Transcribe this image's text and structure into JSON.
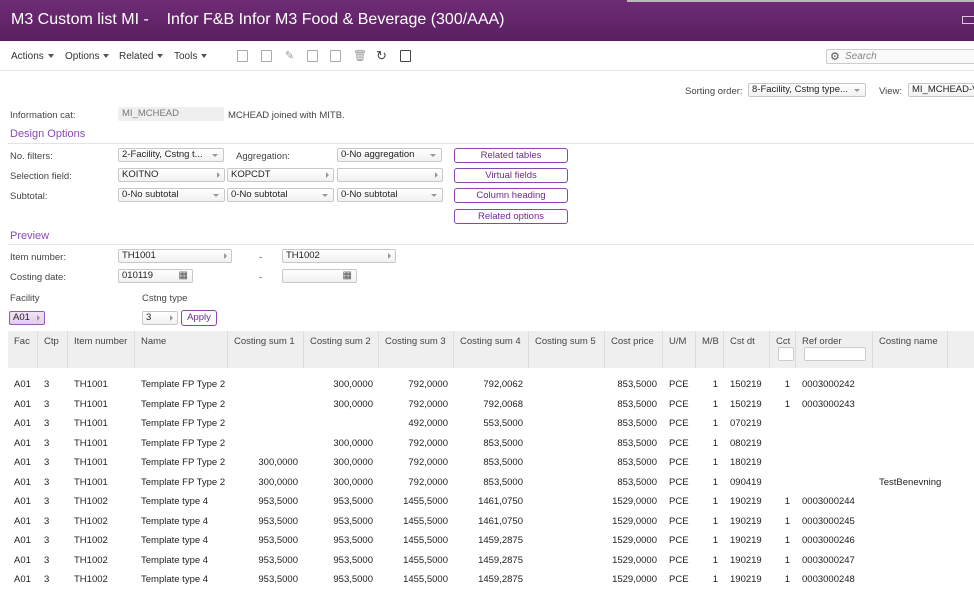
{
  "window": {
    "title": "M3 Custom list MI -    Infor F&B Infor M3 Food & Beverage (300/AAA)"
  },
  "toolbar": {
    "menus": [
      "Actions",
      "Options",
      "Related",
      "Tools"
    ],
    "icons": [
      "new-icon",
      "open-icon",
      "edit-icon",
      "copy-icon",
      "display-icon",
      "delete-icon",
      "refresh-icon",
      "document-icon"
    ],
    "search_placeholder": "Search"
  },
  "sorting": {
    "label": "Sorting order:",
    "value": "8-Facility, Cstng type...",
    "view_label": "View:",
    "view_value": "MI_MCHEAD-V"
  },
  "info": {
    "label": "Information cat:",
    "value": "MI_MCHEAD",
    "description": "MCHEAD joined with MITB."
  },
  "design": {
    "heading": "Design Options",
    "no_filters_label": "No. filters:",
    "no_filters_value": "2-Facility, Cstng t...",
    "aggregation_label": "Aggregation:",
    "aggregation_value": "0-No aggregation",
    "selection_label": "Selection field:",
    "selection_values": [
      "KOITNO",
      "KOPCDT",
      ""
    ],
    "subtotal_label": "Subtotal:",
    "subtotal_values": [
      "0-No subtotal",
      "0-No subtotal",
      "0-No subtotal"
    ],
    "buttons": [
      "Related tables",
      "Virtual fields",
      "Column heading",
      "Related options"
    ]
  },
  "preview": {
    "heading": "Preview",
    "item_label": "Item number:",
    "item_from": "TH1001",
    "item_to": "TH1002",
    "date_label": "Costing date:",
    "date_from": "010119",
    "date_to": "",
    "dash": "-",
    "facility_label": "Facility",
    "facility_value": "A01",
    "cstng_label": "Cstng type",
    "cstng_value": "3",
    "apply_label": "Apply"
  },
  "grid": {
    "columns": [
      "Fac",
      "Ctp",
      "Item number",
      "Name",
      "Costing sum 1",
      "Costing sum 2",
      "Costing sum 3",
      "Costing sum 4",
      "Costing sum 5",
      "Cost price",
      "U/M",
      "M/B",
      "Cst dt",
      "Cct",
      "Ref order",
      "Costing name"
    ],
    "rows": [
      [
        "A01",
        "3",
        "TH1001",
        "Template FP Type 2",
        "",
        "300,0000",
        "792,0000",
        "792,0062",
        "",
        "853,5000",
        "PCE",
        "1",
        "150219",
        "1",
        "0003000242",
        ""
      ],
      [
        "A01",
        "3",
        "TH1001",
        "Template FP Type 2",
        "",
        "300,0000",
        "792,0000",
        "792,0068",
        "",
        "853,5000",
        "PCE",
        "1",
        "150219",
        "1",
        "0003000243",
        ""
      ],
      [
        "A01",
        "3",
        "TH1001",
        "Template FP Type 2",
        "",
        "",
        "492,0000",
        "553,5000",
        "",
        "853,5000",
        "PCE",
        "1",
        "070219",
        "",
        "",
        ""
      ],
      [
        "A01",
        "3",
        "TH1001",
        "Template FP Type 2",
        "",
        "300,0000",
        "792,0000",
        "853,5000",
        "",
        "853,5000",
        "PCE",
        "1",
        "080219",
        "",
        "",
        ""
      ],
      [
        "A01",
        "3",
        "TH1001",
        "Template FP Type 2",
        "300,0000",
        "300,0000",
        "792,0000",
        "853,5000",
        "",
        "853,5000",
        "PCE",
        "1",
        "180219",
        "",
        "",
        ""
      ],
      [
        "A01",
        "3",
        "TH1001",
        "Template FP Type 2",
        "300,0000",
        "300,0000",
        "792,0000",
        "853,5000",
        "",
        "853,5000",
        "PCE",
        "1",
        "090419",
        "",
        "",
        "TestBenevning"
      ],
      [
        "A01",
        "3",
        "TH1002",
        "Template type 4",
        "953,5000",
        "953,5000",
        "1455,5000",
        "1461,0750",
        "",
        "1529,0000",
        "PCE",
        "1",
        "190219",
        "1",
        "0003000244",
        ""
      ],
      [
        "A01",
        "3",
        "TH1002",
        "Template type 4",
        "953,5000",
        "953,5000",
        "1455,5000",
        "1461,0750",
        "",
        "1529,0000",
        "PCE",
        "1",
        "190219",
        "1",
        "0003000245",
        ""
      ],
      [
        "A01",
        "3",
        "TH1002",
        "Template type 4",
        "953,5000",
        "953,5000",
        "1455,5000",
        "1459,2875",
        "",
        "1529,0000",
        "PCE",
        "1",
        "190219",
        "1",
        "0003000246",
        ""
      ],
      [
        "A01",
        "3",
        "TH1002",
        "Template type 4",
        "953,5000",
        "953,5000",
        "1455,5000",
        "1459,2875",
        "",
        "1529,0000",
        "PCE",
        "1",
        "190219",
        "1",
        "0003000247",
        ""
      ],
      [
        "A01",
        "3",
        "TH1002",
        "Template type 4",
        "953,5000",
        "953,5000",
        "1455,5000",
        "1459,2875",
        "",
        "1529,0000",
        "PCE",
        "1",
        "190219",
        "1",
        "0003000248",
        ""
      ]
    ]
  },
  "colors": {
    "brand": "#5f2366",
    "accent": "#8a4bb0"
  }
}
